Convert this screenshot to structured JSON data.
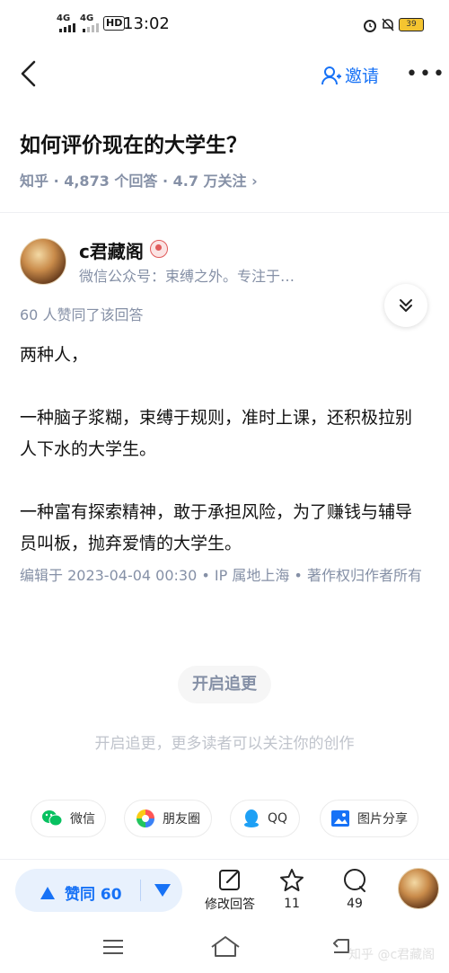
{
  "status_bar": {
    "net1": "4G",
    "net2": "4G",
    "hd": "HD",
    "time": "13:02",
    "battery": "39"
  },
  "nav": {
    "invite_label": "邀请",
    "more_label": "•••"
  },
  "question": {
    "title": "如何评价现在的大学生？",
    "meta": "知乎 · 4,873 个回答 · 4.7 万关注 ›"
  },
  "answer": {
    "author_name": "c君藏阁",
    "author_desc": "微信公众号：束缚之外。专注于…",
    "votes_line": "60 人赞同了该回答",
    "paragraphs": [
      "两种人，",
      "一种脑子浆糊，束缚于规则，准时上课，还积极拉别人下水的大学生。",
      "一种富有探索精神，敢于承担风险，为了赚钱与辅导员叫板，抛弃爱情的大学生。"
    ],
    "edit_info": "编辑于 2023-04-04 00:30 • IP 属地上海 • 著作权归作者所有",
    "follow_button": "开启追更",
    "follow_tip": "开启追更，更多读者可以关注你的创作"
  },
  "share": {
    "wechat": "微信",
    "moments": "朋友圈",
    "qq": "QQ",
    "image_share": "图片分享"
  },
  "bottom_bar": {
    "vote_label": "赞同 60",
    "edit_label": "修改回答",
    "star_count": "11",
    "comment_count": "49"
  },
  "watermark": "知乎 @c君藏阁",
  "colors": {
    "accent": "#1772f6",
    "meta": "#8590a6",
    "vote_bg": "#e8f1fd"
  }
}
